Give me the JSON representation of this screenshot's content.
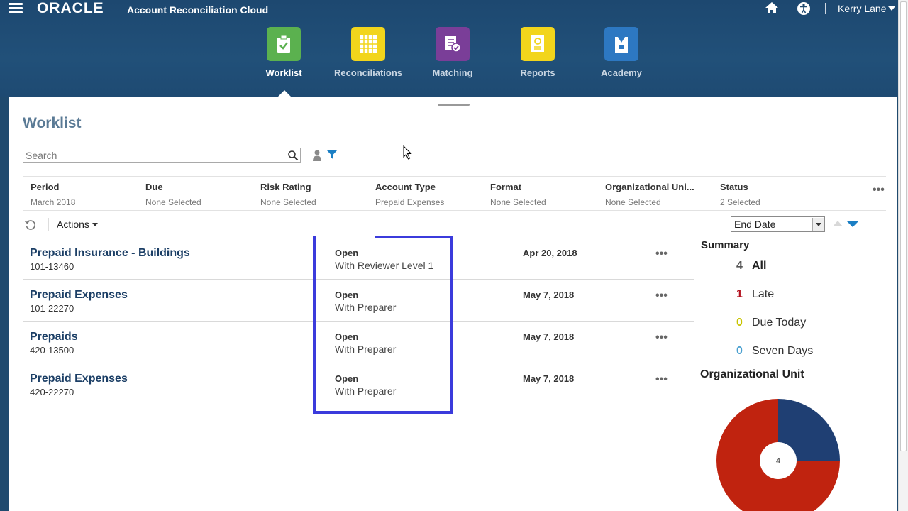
{
  "header": {
    "brand": "ORACLE",
    "app_title": "Account Reconciliation Cloud",
    "user_name": "Kerry Lane",
    "icons": [
      "menu-icon",
      "home-icon",
      "accessibility-icon"
    ]
  },
  "nav": [
    {
      "label": "Worklist",
      "color": "#5bb14f",
      "icon": "clipboard-check-icon",
      "active": true
    },
    {
      "label": "Reconciliations",
      "color": "#f2d51c",
      "icon": "grid-icon",
      "active": false
    },
    {
      "label": "Matching",
      "color": "#7a3e98",
      "icon": "document-check-icon",
      "active": false
    },
    {
      "label": "Reports",
      "color": "#f2d51c",
      "icon": "report-icon",
      "active": false
    },
    {
      "label": "Academy",
      "color": "#2d78c2",
      "icon": "academy-icon",
      "active": false
    }
  ],
  "page": {
    "title": "Worklist",
    "search_placeholder": "Search"
  },
  "filters": [
    {
      "label": "Period",
      "value": "March 2018"
    },
    {
      "label": "Due",
      "value": "None Selected"
    },
    {
      "label": "Risk Rating",
      "value": "None Selected"
    },
    {
      "label": "Account Type",
      "value": "Prepaid Expenses"
    },
    {
      "label": "Format",
      "value": "None Selected"
    },
    {
      "label": "Organizational Uni...",
      "value": "None Selected"
    },
    {
      "label": "Status",
      "value": "2 Selected"
    }
  ],
  "toolbar": {
    "actions_label": "Actions",
    "sort_by": "End Date",
    "more": "•••"
  },
  "rows": [
    {
      "name": "Prepaid Insurance - Buildings",
      "number": "101-13460",
      "status": "Open",
      "substatus": "With Reviewer Level 1",
      "due": "Apr 20, 2018",
      "more": "•••"
    },
    {
      "name": "Prepaid Expenses",
      "number": "101-22270",
      "status": "Open",
      "substatus": "With Preparer",
      "due": "May 7, 2018",
      "more": "•••"
    },
    {
      "name": "Prepaids",
      "number": "420-13500",
      "status": "Open",
      "substatus": "With Preparer",
      "due": "May 7, 2018",
      "more": "•••"
    },
    {
      "name": "Prepaid Expenses",
      "number": "420-22270",
      "status": "Open",
      "substatus": "With Preparer",
      "due": "May 7, 2018",
      "more": "•••"
    }
  ],
  "summary": {
    "title": "Summary",
    "items": [
      {
        "count": "4",
        "label": "All",
        "color": "#555555"
      },
      {
        "count": "1",
        "label": "Late",
        "color": "#b3121f"
      },
      {
        "count": "0",
        "label": "Due Today",
        "color": "#c8c400"
      },
      {
        "count": "0",
        "label": "Seven Days",
        "color": "#4aa0d0"
      }
    ],
    "org_title": "Organizational Unit",
    "donut_center": "4",
    "donut_slices": [
      {
        "value": 1,
        "color": "#1f3f73"
      },
      {
        "value": 3,
        "color": "#c0230f"
      }
    ]
  }
}
